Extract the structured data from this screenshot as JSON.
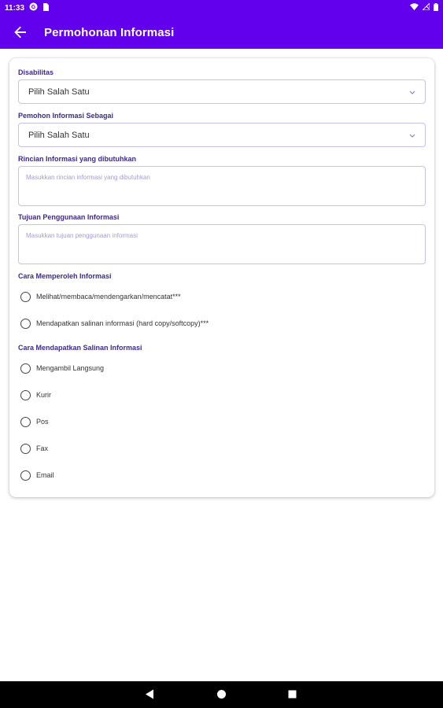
{
  "status_bar": {
    "time": "11:33",
    "icons": [
      "g-icon",
      "sim-card-icon",
      "wifi-icon",
      "no-signal-icon",
      "battery-icon"
    ]
  },
  "app_bar": {
    "title": "Permohonan Informasi",
    "back_icon": "arrow-back-icon",
    "color": "#6200ee"
  },
  "form": {
    "disabilitas": {
      "label": "Disabilitas",
      "value": "Pilih Salah Satu"
    },
    "pemohon": {
      "label": "Pemohon Informasi Sebagai",
      "value": "Pilih Salah Satu"
    },
    "rincian": {
      "label": "Rincian Informasi yang dibutuhkan",
      "placeholder": "Masukkan rincian informasi yang dibutuhkan"
    },
    "tujuan": {
      "label": "Tujuan Penggunaan Informasi",
      "placeholder": "Masukkan tujuan penggunaan informasi"
    },
    "cara_memperoleh": {
      "label": "Cara Memperoleh Informasi",
      "options": [
        "Melihat/membaca/mendengarkan/mencatat***",
        "Mendapatkan salinan informasi (hard copy/softcopy)***"
      ]
    },
    "cara_mendapatkan": {
      "label": "Cara Mendapatkan Salinan Informasi",
      "options": [
        "Mengambil Langsung",
        "Kurir",
        "Pos",
        "Fax",
        "Email"
      ]
    }
  },
  "nav_bar": {
    "icons": [
      "back-triangle-icon",
      "home-circle-icon",
      "recents-square-icon"
    ]
  }
}
